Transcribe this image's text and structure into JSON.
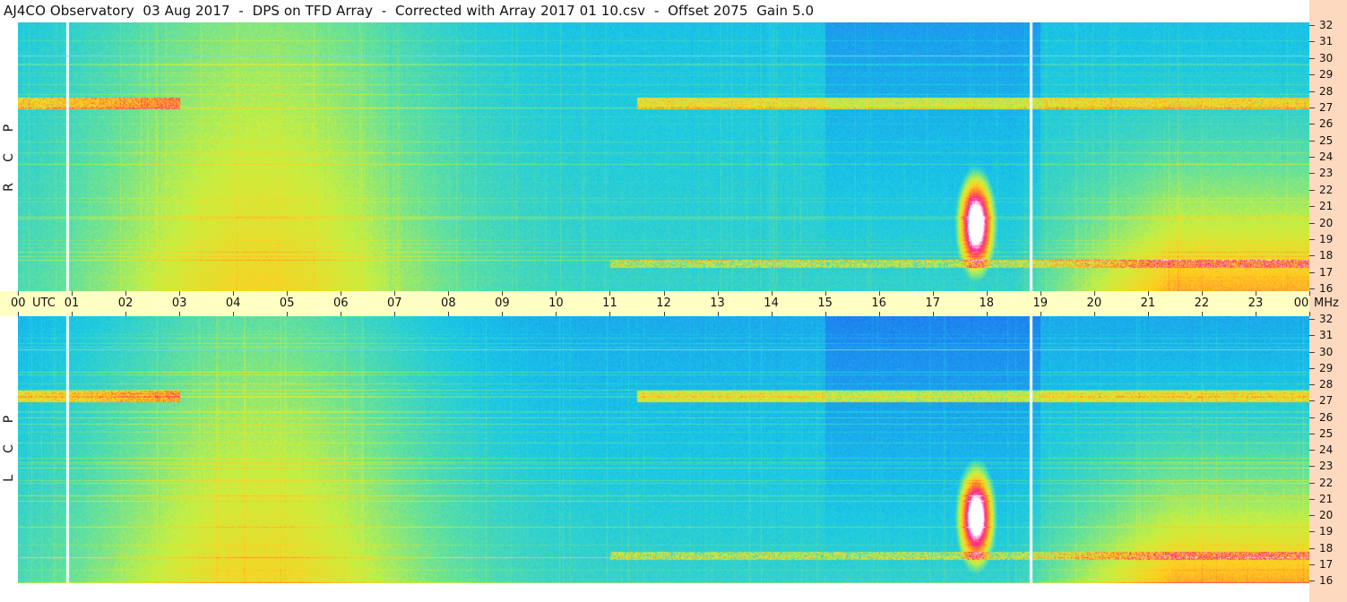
{
  "title": "AJ4CO Observatory  03 Aug 2017  -  DPS on TFD Array  -  Corrected with Array 2017 01 10.csv  -  Offset 2075  Gain 5.0",
  "time_axis": {
    "start_label": "00",
    "utc_label": "UTC",
    "labels": [
      "01",
      "02",
      "03",
      "04",
      "05",
      "06",
      "07",
      "08",
      "09",
      "10",
      "11",
      "12",
      "13",
      "14",
      "15",
      "16",
      "17",
      "18",
      "19",
      "20",
      "21",
      "22",
      "23"
    ],
    "end_label": "00",
    "unit_label": "MHz"
  },
  "panels": [
    {
      "id": "rcp",
      "polarization_letters": [
        "R",
        "C",
        "P"
      ]
    },
    {
      "id": "lcp",
      "polarization_letters": [
        "L",
        "C",
        "P"
      ]
    }
  ],
  "frequency_labels": [
    "32",
    "31",
    "30",
    "29",
    "28",
    "27",
    "26",
    "25",
    "24",
    "23",
    "22",
    "21",
    "20",
    "19",
    "18",
    "17",
    "16"
  ],
  "colors": {
    "background_right": "#fdd9bf",
    "axis_band": "#ffffc4"
  },
  "chart_data": [
    {
      "type": "heatmap",
      "title": "R C P",
      "x_range_utc_hours": [
        0,
        24
      ],
      "y_range_mhz": [
        16,
        32
      ],
      "colormap": [
        "#1450e6",
        "#1e8cf0",
        "#18c8e6",
        "#60e0a0",
        "#c8f040",
        "#ffd020",
        "#ff7a30",
        "#ff2090",
        "#ffffff"
      ],
      "features": [
        {
          "name": "storm",
          "utc_hours": [
            17.4,
            18.2
          ],
          "mhz": [
            16.5,
            23.5
          ]
        },
        {
          "name": "vertical_gaps",
          "utc_hours": [
            0.9,
            18.8
          ]
        }
      ]
    },
    {
      "type": "heatmap",
      "title": "L C P",
      "x_range_utc_hours": [
        0,
        24
      ],
      "y_range_mhz": [
        16,
        32
      ],
      "colormap": [
        "#1450e6",
        "#1e8cf0",
        "#18c8e6",
        "#60e0a0",
        "#c8f040",
        "#ffd020",
        "#ff7a30",
        "#ff2090",
        "#ffffff"
      ],
      "features": [
        {
          "name": "storm",
          "utc_hours": [
            17.4,
            18.2
          ],
          "mhz": [
            16.5,
            23.5
          ]
        },
        {
          "name": "vertical_gaps",
          "utc_hours": [
            0.9,
            18.8
          ]
        }
      ]
    }
  ]
}
